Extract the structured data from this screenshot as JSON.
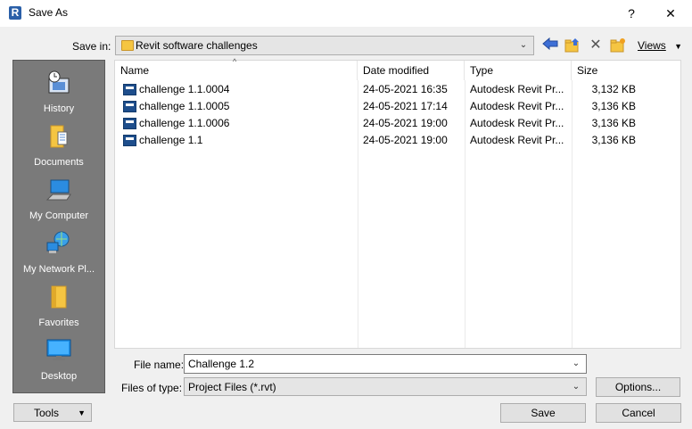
{
  "window": {
    "title": "Save As",
    "app_icon_letter": "R",
    "help_label": "?",
    "close_label": "✕"
  },
  "save_in": {
    "label": "Save in:",
    "value": "Revit software challenges"
  },
  "toolbar": {
    "views_label": "Views"
  },
  "places": [
    {
      "label": "History",
      "icon": "history-icon"
    },
    {
      "label": "Documents",
      "icon": "documents-icon"
    },
    {
      "label": "My Computer",
      "icon": "computer-icon"
    },
    {
      "label": "My Network Pl...",
      "icon": "network-icon"
    },
    {
      "label": "Favorites",
      "icon": "favorites-icon"
    },
    {
      "label": "Desktop",
      "icon": "desktop-icon"
    }
  ],
  "columns": {
    "name": "Name",
    "date": "Date modified",
    "type": "Type",
    "size": "Size"
  },
  "files": [
    {
      "name": "challenge 1.1.0004",
      "date": "24-05-2021 16:35",
      "type": "Autodesk Revit Pr...",
      "size": "3,132 KB"
    },
    {
      "name": "challenge 1.1.0005",
      "date": "24-05-2021 17:14",
      "type": "Autodesk Revit Pr...",
      "size": "3,136 KB"
    },
    {
      "name": "challenge 1.1.0006",
      "date": "24-05-2021 19:00",
      "type": "Autodesk Revit Pr...",
      "size": "3,136 KB"
    },
    {
      "name": "challenge 1.1",
      "date": "24-05-2021 19:00",
      "type": "Autodesk Revit Pr...",
      "size": "3,136 KB"
    }
  ],
  "file_name": {
    "label": "File name:",
    "value": "Challenge 1.2"
  },
  "file_type": {
    "label": "Files of type:",
    "value": "Project Files  (*.rvt)"
  },
  "buttons": {
    "options": "Options...",
    "tools": "Tools",
    "save": "Save",
    "cancel": "Cancel"
  },
  "colors": {
    "places_bg": "#7a7a7a",
    "revit_blue": "#1e4e8c",
    "folder_yellow": "#f5c542"
  }
}
